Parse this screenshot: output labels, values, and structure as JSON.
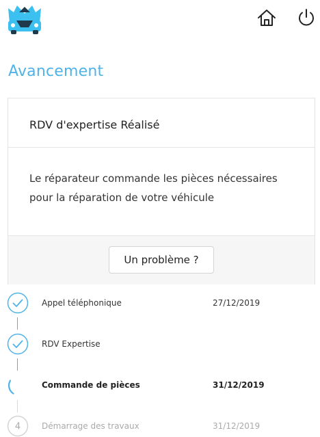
{
  "header": {
    "logo": "car-logo-icon",
    "home_icon": "home-icon",
    "power_icon": "power-icon"
  },
  "page": {
    "title": "Avancement"
  },
  "status_card": {
    "title": "RDV d'expertise Réalisé",
    "description": "Le réparateur commande les pièces nécessaires pour la réparation de votre véhicule",
    "problem_button": "Un problème ?"
  },
  "steps": [
    {
      "label": "Appel téléphonique",
      "date": "27/12/2019",
      "state": "done"
    },
    {
      "label": "RDV Expertise",
      "date": "",
      "state": "done"
    },
    {
      "label": "Commande de pièces",
      "date": "31/12/2019",
      "state": "active"
    },
    {
      "number": "4",
      "label": "Démarrage des travaux",
      "date": "31/12/2019",
      "state": "pending"
    }
  ],
  "colors": {
    "accent": "#4fb3e8",
    "logo_blue": "#3cc0ef",
    "logo_dark": "#1e3a4c",
    "pending_grey": "#aaaaaa"
  }
}
